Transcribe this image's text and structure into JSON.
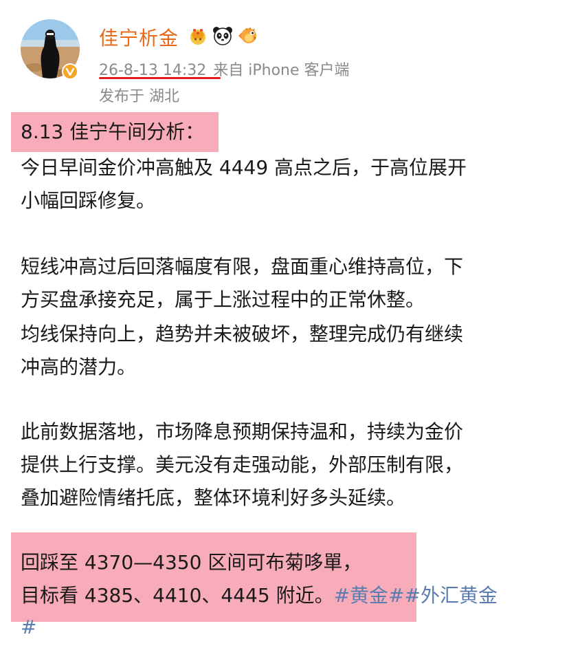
{
  "author": {
    "name": "佳宁析金",
    "badges": [
      "crown-icon",
      "panda-icon",
      "pufferfish-icon"
    ],
    "verified_icon": "verified-v-icon"
  },
  "meta": {
    "time": "26-8-13 14:32",
    "source": "来自 iPhone 客户端",
    "location": "发布于 湖北"
  },
  "post": {
    "title": "8.13 佳宁午间分析：",
    "p1_line1": "今日早间金价冲高触及 4449 高点之后，于高位展开",
    "p1_line2": "小幅回踩修复。",
    "p2_line1": "短线冲高过后回落幅度有限，盘面重心维持高位，下",
    "p2_line2": "方买盘承接充足，属于上涨过程中的正常休整。",
    "p2_line3": "均线保持向上，趋势并未被破坏，整理完成仍有继续",
    "p2_line4": "冲高的潜力。",
    "p3_line1": "此前数据落地，市场降息预期保持温和，持续为金价",
    "p3_line2": "提供上行支撑。美元没有走强动能，外部压制有限，",
    "p3_line3": "叠加避险情绪托底，整体环境利好多头延续。",
    "p4_line1": "回踩至 4370—4350 区间可布菊哆單，",
    "p4_line2": "目标看 4385、4410、4445 附近。",
    "hashtag1": "#黄金#",
    "hashtag2": "#外汇黄金",
    "hashtag2_end": "#"
  },
  "colors": {
    "username": "#e8691b",
    "meta": "#8a8a8a",
    "underline": "#e21b1b",
    "highlight": "#f4788c",
    "hashtag": "#5b7cb0"
  }
}
